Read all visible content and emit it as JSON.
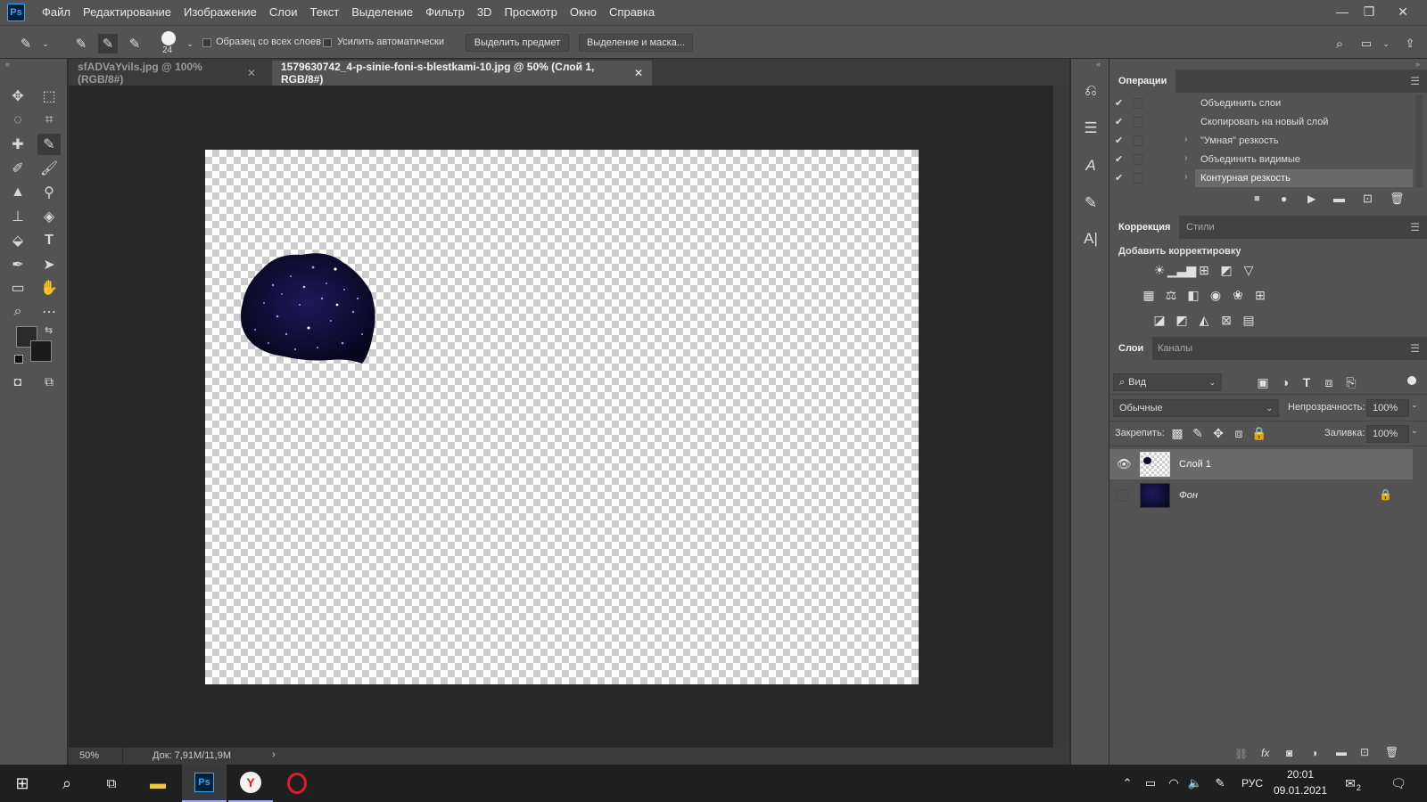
{
  "app": {
    "logo": "Ps"
  },
  "menu": [
    "Файл",
    "Редактирование",
    "Изображение",
    "Слои",
    "Текст",
    "Выделение",
    "Фильтр",
    "3D",
    "Просмотр",
    "Окно",
    "Справка"
  ],
  "options": {
    "brush_size": "24",
    "sample_all_layers": "Образец со всех слоев",
    "auto_enhance": "Усилить автоматически",
    "select_subject": "Выделить предмет",
    "select_and_mask": "Выделение и маска..."
  },
  "tabs": [
    {
      "label": "sfADVaYvils.jpg @ 100% (RGB/8#)",
      "active": false
    },
    {
      "label": "1579630742_4-p-sinie-foni-s-blestkami-10.jpg @ 50% (Слой 1, RGB/8#)",
      "active": true
    }
  ],
  "status": {
    "zoom": "50%",
    "doc": "Док: 7,91M/11,9M"
  },
  "operations": {
    "title": "Операции",
    "items": [
      {
        "label": "Объединить слои",
        "expandable": false,
        "selected": false
      },
      {
        "label": "Скопировать на новый слой",
        "expandable": false,
        "selected": false
      },
      {
        "label": "\"Умная\" резкость",
        "expandable": true,
        "selected": false
      },
      {
        "label": "Объединить видимые",
        "expandable": true,
        "selected": false
      },
      {
        "label": "Контурная резкость",
        "expandable": true,
        "selected": true
      }
    ]
  },
  "adjustments": {
    "tab_active": "Коррекция",
    "tab_other": "Стили",
    "add_label": "Добавить корректировку"
  },
  "layers": {
    "tab_active": "Слои",
    "tab_other": "Каналы",
    "filter_label": "Вид",
    "blend_mode": "Обычные",
    "opacity_label": "Непрозрачность:",
    "opacity_value": "100%",
    "lock_label": "Закрепить:",
    "fill_label": "Заливка:",
    "fill_value": "100%",
    "items": [
      {
        "name": "Слой 1",
        "visible": true,
        "selected": true,
        "locked": false
      },
      {
        "name": "Фон",
        "visible": false,
        "selected": false,
        "locked": true
      }
    ]
  },
  "taskbar": {
    "lang": "РУС",
    "time": "20:01",
    "date": "09.01.2021",
    "notif_count": "2"
  },
  "colors": {
    "accent": "#31a8ff",
    "foreground": "#2b2b2b",
    "background": "#1a1a1a"
  }
}
